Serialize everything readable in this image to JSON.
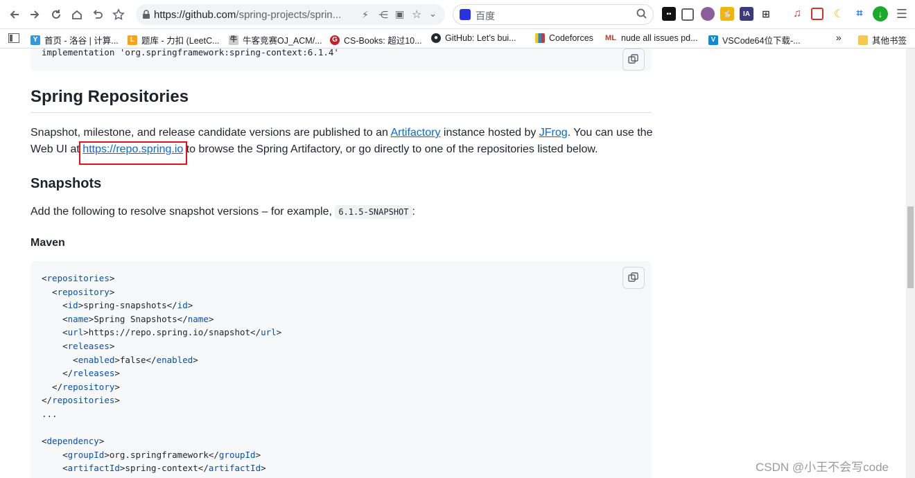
{
  "browser": {
    "url_host": "https://github.com",
    "url_path": "/spring-projects/sprin...",
    "search_engine_placeholder": "百度"
  },
  "bookmarks": [
    {
      "label": "首页 - 洛谷 | 计算...",
      "icon": "luogu-icon"
    },
    {
      "label": "题库 - 力扣 (LeetC...",
      "icon": "leetcode-icon"
    },
    {
      "label": "牛客竞赛OJ_ACM/...",
      "icon": "nowcoder-icon"
    },
    {
      "label": "CS-Books: 超过10...",
      "icon": "gitee-icon"
    },
    {
      "label": "GitHub: Let’s bui...",
      "icon": "github-icon"
    },
    {
      "label": "Codeforces",
      "icon": "codeforces-icon"
    },
    {
      "label": "nude all issues pd...",
      "icon": "ml-icon"
    },
    {
      "label": "VSCode64位下载-...",
      "icon": "vscode-icon"
    },
    {
      "label": "»",
      "icon": ""
    },
    {
      "label": "其他书签",
      "icon": "folder-icon"
    }
  ],
  "page": {
    "top_code_line": "implementation 'org.springframework:spring-context:6.1.4'",
    "section_title": "Spring Repositories",
    "intro": {
      "t1": "Snapshot, milestone, and release candidate versions are published to an ",
      "link_artifactory": "Artifactory",
      "t2": " instance hosted by ",
      "link_jfrog": "JFrog",
      "t3": ". You can use the",
      "t4": "Web UI at ",
      "link_repo": "https://repo.spring.io",
      "t5": " to browse the Spring Artifactory, or go directly to one of the repositories listed below."
    },
    "snapshots_title": "Snapshots",
    "snapshots_text_1": "Add the following to resolve snapshot versions – for example, ",
    "snapshots_code": "6.1.5-SNAPSHOT",
    "snapshots_text_2": ":",
    "maven_title": "Maven",
    "maven_lines": [
      "<repositories>",
      "  <repository>",
      "    <id>spring-snapshots</id>",
      "    <name>Spring Snapshots</name>",
      "    <url>https://repo.spring.io/snapshot</url>",
      "    <releases>",
      "      <enabled>false</enabled>",
      "    </releases>",
      "  </repository>",
      "</repositories>",
      "...",
      "",
      "<dependency>",
      "    <groupId>org.springframework</groupId>",
      "    <artifactId>spring-context</artifactId>"
    ]
  },
  "watermark": "CSDN @小王不会写code"
}
